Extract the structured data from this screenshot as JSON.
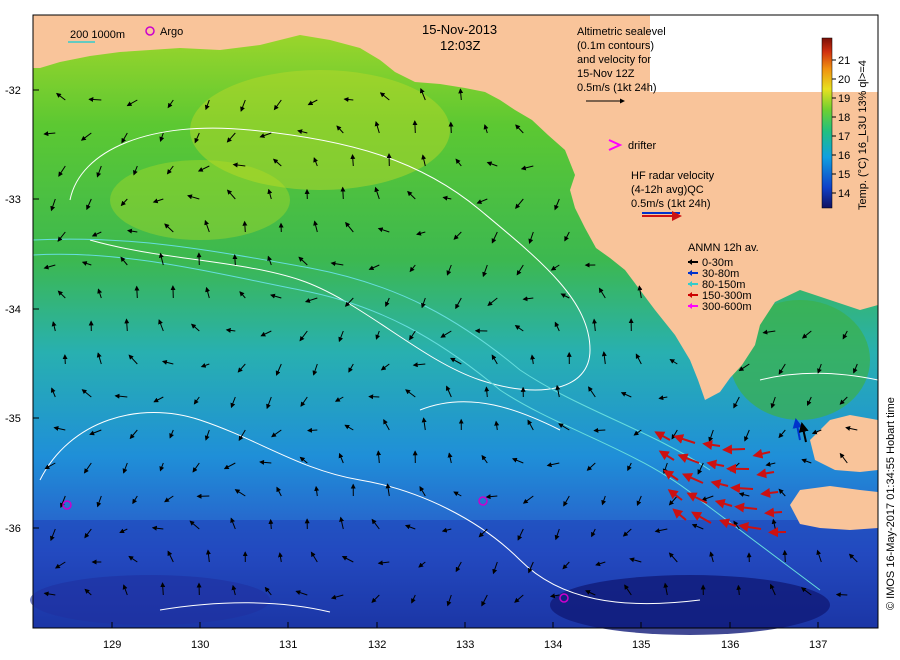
{
  "title": {
    "date": "15-Nov-2013",
    "time": "12:03Z"
  },
  "legend": {
    "isobath_label": "200  1000m",
    "argo_label": "Argo",
    "altimetry": [
      "Altimetric sealevel",
      "(0.1m contours)",
      "and velocity for",
      "15-Nov 12Z",
      "0.5m/s (1kt 24h)"
    ],
    "drifter_label": "drifter",
    "hf_radar": [
      "HF radar velocity",
      "(4-12h avg)QC",
      "0.5m/s (1kt 24h)"
    ],
    "anmn_title": "ANMN 12h av.",
    "anmn_items": [
      {
        "label": "0-30m",
        "color": "#000000"
      },
      {
        "label": "30-80m",
        "color": "#0033cc"
      },
      {
        "label": "80-150m",
        "color": "#33cccc"
      },
      {
        "label": "150-300m",
        "color": "#cc0000"
      },
      {
        "label": "300-600m",
        "color": "#ff00ff"
      }
    ]
  },
  "colorbar": {
    "ticks": [
      "21",
      "20",
      "19",
      "18",
      "17",
      "16",
      "15",
      "14"
    ],
    "label": "Temp. (°C) 16_L3U 13% ql>=4"
  },
  "y_axis": [
    "-32",
    "-33",
    "-34",
    "-35",
    "-36"
  ],
  "x_axis": [
    "129",
    "130",
    "131",
    "132",
    "133",
    "134",
    "135",
    "136",
    "137"
  ],
  "credit": "© IMOS 16-May-2017 01:34:55 Hobart time",
  "colors": {
    "land": "#f9c49a",
    "argo": "#cc00cc",
    "hf": "#cc1111",
    "contour": "#ffffff",
    "isobath": "#33cccc"
  }
}
